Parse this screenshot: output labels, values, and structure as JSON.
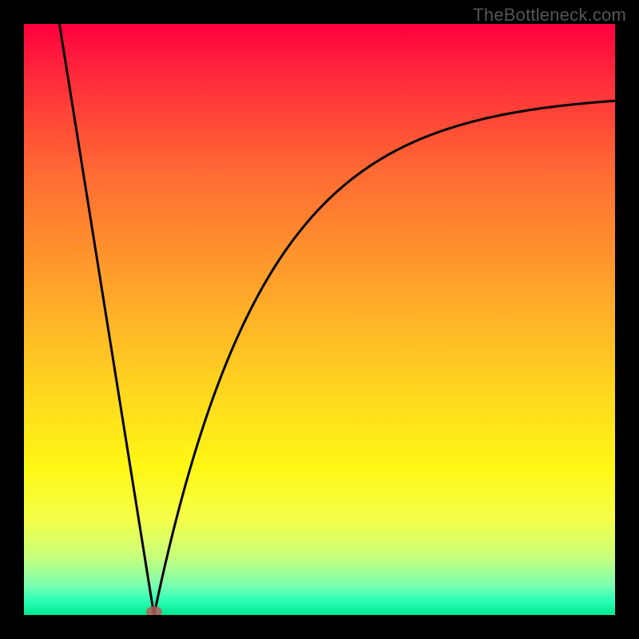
{
  "watermark": "TheBottleneck.com",
  "chart_data": {
    "type": "line",
    "title": "",
    "xlabel": "",
    "ylabel": "",
    "xlim": [
      0,
      100
    ],
    "ylim": [
      0,
      100
    ],
    "grid": false,
    "curve": {
      "description": "V-shaped bottleneck curve: steep linear descent from top-left to a minimum near x≈22, then a concave-up rise that asymptotes near the top-right.",
      "min_x": 22,
      "min_y": 0,
      "left_endpoint": {
        "x": 6,
        "y": 100
      },
      "right_endpoint": {
        "x": 100,
        "y": 87
      }
    },
    "marker": {
      "x": 22,
      "y": 0,
      "color": "#b55a5a"
    },
    "gradient_stops": [
      {
        "offset": 0.0,
        "color": "#ff003e"
      },
      {
        "offset": 0.1,
        "color": "#ff2f3a"
      },
      {
        "offset": 0.25,
        "color": "#ff6a33"
      },
      {
        "offset": 0.45,
        "color": "#ffa52a"
      },
      {
        "offset": 0.62,
        "color": "#ffd61f"
      },
      {
        "offset": 0.75,
        "color": "#fff714"
      },
      {
        "offset": 0.84,
        "color": "#f4ff4a"
      },
      {
        "offset": 0.9,
        "color": "#c9ff7a"
      },
      {
        "offset": 0.95,
        "color": "#7bffb0"
      },
      {
        "offset": 0.975,
        "color": "#2dffb8"
      },
      {
        "offset": 1.0,
        "color": "#00e88a"
      }
    ]
  }
}
